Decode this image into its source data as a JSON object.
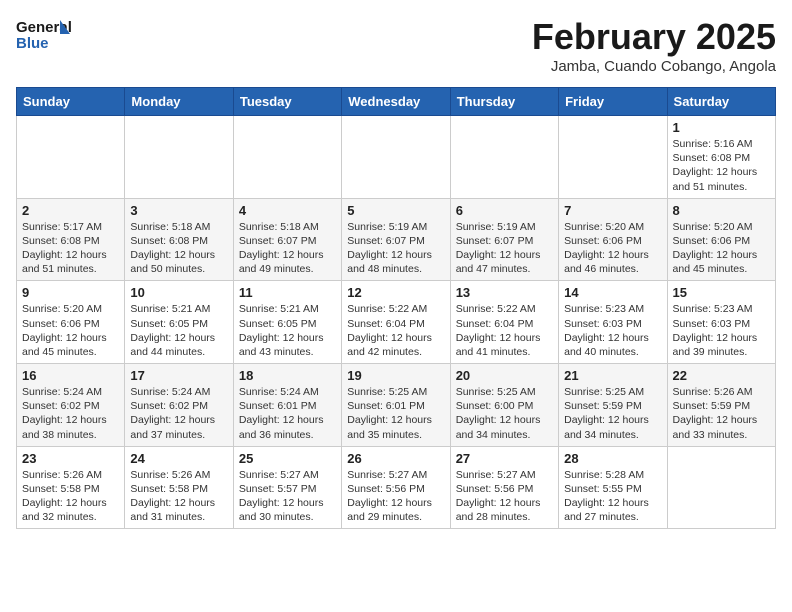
{
  "header": {
    "logo_line1": "General",
    "logo_line2": "Blue",
    "month_title": "February 2025",
    "location": "Jamba, Cuando Cobango, Angola"
  },
  "days_of_week": [
    "Sunday",
    "Monday",
    "Tuesday",
    "Wednesday",
    "Thursday",
    "Friday",
    "Saturday"
  ],
  "weeks": [
    [
      {
        "day": "",
        "info": ""
      },
      {
        "day": "",
        "info": ""
      },
      {
        "day": "",
        "info": ""
      },
      {
        "day": "",
        "info": ""
      },
      {
        "day": "",
        "info": ""
      },
      {
        "day": "",
        "info": ""
      },
      {
        "day": "1",
        "info": "Sunrise: 5:16 AM\nSunset: 6:08 PM\nDaylight: 12 hours\nand 51 minutes."
      }
    ],
    [
      {
        "day": "2",
        "info": "Sunrise: 5:17 AM\nSunset: 6:08 PM\nDaylight: 12 hours\nand 51 minutes."
      },
      {
        "day": "3",
        "info": "Sunrise: 5:18 AM\nSunset: 6:08 PM\nDaylight: 12 hours\nand 50 minutes."
      },
      {
        "day": "4",
        "info": "Sunrise: 5:18 AM\nSunset: 6:07 PM\nDaylight: 12 hours\nand 49 minutes."
      },
      {
        "day": "5",
        "info": "Sunrise: 5:19 AM\nSunset: 6:07 PM\nDaylight: 12 hours\nand 48 minutes."
      },
      {
        "day": "6",
        "info": "Sunrise: 5:19 AM\nSunset: 6:07 PM\nDaylight: 12 hours\nand 47 minutes."
      },
      {
        "day": "7",
        "info": "Sunrise: 5:20 AM\nSunset: 6:06 PM\nDaylight: 12 hours\nand 46 minutes."
      },
      {
        "day": "8",
        "info": "Sunrise: 5:20 AM\nSunset: 6:06 PM\nDaylight: 12 hours\nand 45 minutes."
      }
    ],
    [
      {
        "day": "9",
        "info": "Sunrise: 5:20 AM\nSunset: 6:06 PM\nDaylight: 12 hours\nand 45 minutes."
      },
      {
        "day": "10",
        "info": "Sunrise: 5:21 AM\nSunset: 6:05 PM\nDaylight: 12 hours\nand 44 minutes."
      },
      {
        "day": "11",
        "info": "Sunrise: 5:21 AM\nSunset: 6:05 PM\nDaylight: 12 hours\nand 43 minutes."
      },
      {
        "day": "12",
        "info": "Sunrise: 5:22 AM\nSunset: 6:04 PM\nDaylight: 12 hours\nand 42 minutes."
      },
      {
        "day": "13",
        "info": "Sunrise: 5:22 AM\nSunset: 6:04 PM\nDaylight: 12 hours\nand 41 minutes."
      },
      {
        "day": "14",
        "info": "Sunrise: 5:23 AM\nSunset: 6:03 PM\nDaylight: 12 hours\nand 40 minutes."
      },
      {
        "day": "15",
        "info": "Sunrise: 5:23 AM\nSunset: 6:03 PM\nDaylight: 12 hours\nand 39 minutes."
      }
    ],
    [
      {
        "day": "16",
        "info": "Sunrise: 5:24 AM\nSunset: 6:02 PM\nDaylight: 12 hours\nand 38 minutes."
      },
      {
        "day": "17",
        "info": "Sunrise: 5:24 AM\nSunset: 6:02 PM\nDaylight: 12 hours\nand 37 minutes."
      },
      {
        "day": "18",
        "info": "Sunrise: 5:24 AM\nSunset: 6:01 PM\nDaylight: 12 hours\nand 36 minutes."
      },
      {
        "day": "19",
        "info": "Sunrise: 5:25 AM\nSunset: 6:01 PM\nDaylight: 12 hours\nand 35 minutes."
      },
      {
        "day": "20",
        "info": "Sunrise: 5:25 AM\nSunset: 6:00 PM\nDaylight: 12 hours\nand 34 minutes."
      },
      {
        "day": "21",
        "info": "Sunrise: 5:25 AM\nSunset: 5:59 PM\nDaylight: 12 hours\nand 34 minutes."
      },
      {
        "day": "22",
        "info": "Sunrise: 5:26 AM\nSunset: 5:59 PM\nDaylight: 12 hours\nand 33 minutes."
      }
    ],
    [
      {
        "day": "23",
        "info": "Sunrise: 5:26 AM\nSunset: 5:58 PM\nDaylight: 12 hours\nand 32 minutes."
      },
      {
        "day": "24",
        "info": "Sunrise: 5:26 AM\nSunset: 5:58 PM\nDaylight: 12 hours\nand 31 minutes."
      },
      {
        "day": "25",
        "info": "Sunrise: 5:27 AM\nSunset: 5:57 PM\nDaylight: 12 hours\nand 30 minutes."
      },
      {
        "day": "26",
        "info": "Sunrise: 5:27 AM\nSunset: 5:56 PM\nDaylight: 12 hours\nand 29 minutes."
      },
      {
        "day": "27",
        "info": "Sunrise: 5:27 AM\nSunset: 5:56 PM\nDaylight: 12 hours\nand 28 minutes."
      },
      {
        "day": "28",
        "info": "Sunrise: 5:28 AM\nSunset: 5:55 PM\nDaylight: 12 hours\nand 27 minutes."
      },
      {
        "day": "",
        "info": ""
      }
    ]
  ]
}
